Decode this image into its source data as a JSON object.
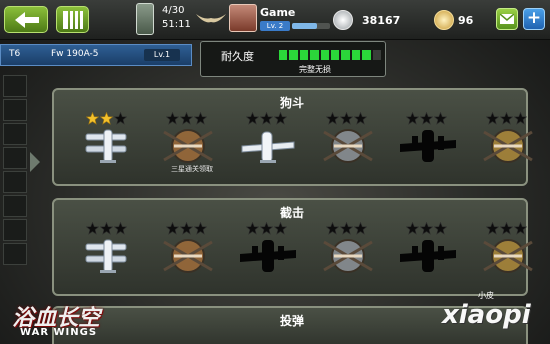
{
  "topbar": {
    "fuel_count": "4/30",
    "fuel_timer": "51:11",
    "player_name": "Game",
    "player_level": "Lv. 2",
    "xp_progress": 0.65,
    "silver": "38167",
    "gold": "96",
    "colors": {
      "button_green": "#6ea32a",
      "button_blue": "#2f7fd0"
    }
  },
  "aircraft": {
    "tier": "T6",
    "name": "Fw 190A-5",
    "level": "Lv.1"
  },
  "durability": {
    "label": "耐久度",
    "filled_segments": 9,
    "total_segments": 10,
    "status": "完整无损",
    "color": "#2bd63a"
  },
  "missions": [
    {
      "title": "狗斗",
      "slots": [
        {
          "stars": 2,
          "plane": "biplane-icon",
          "state": "unlocked"
        },
        {
          "stars": 0,
          "plane": "locked-biplane-emblem-icon",
          "state": "reward",
          "note": "三星通关领取"
        },
        {
          "stars": 0,
          "plane": "monoplane-fighter-icon",
          "state": "unlocked"
        },
        {
          "stars": 0,
          "plane": "locked-fighter-emblem-icon",
          "state": "locked"
        },
        {
          "stars": 0,
          "plane": "bomber-silhouette-icon",
          "state": "silhouette"
        },
        {
          "stars": 0,
          "plane": "locked-bomber-emblem-icon",
          "state": "locked"
        }
      ]
    },
    {
      "title": "截击",
      "slots": [
        {
          "stars": 0,
          "plane": "biplane-icon",
          "state": "unlocked"
        },
        {
          "stars": 0,
          "plane": "locked-biplane-emblem-icon",
          "state": "locked"
        },
        {
          "stars": 0,
          "plane": "fighter-silhouette-icon",
          "state": "silhouette"
        },
        {
          "stars": 0,
          "plane": "locked-fighter-emblem-icon",
          "state": "locked"
        },
        {
          "stars": 0,
          "plane": "bomber-silhouette-icon",
          "state": "silhouette"
        },
        {
          "stars": 0,
          "plane": "locked-bomber-emblem-icon",
          "state": "locked"
        }
      ]
    }
  ],
  "bottom_panel": {
    "title": "投弹"
  },
  "logo": {
    "cn": "浴血长空",
    "en": "WAR WINGS"
  },
  "watermark": {
    "small": "小皮",
    "big": "xiaopi"
  }
}
